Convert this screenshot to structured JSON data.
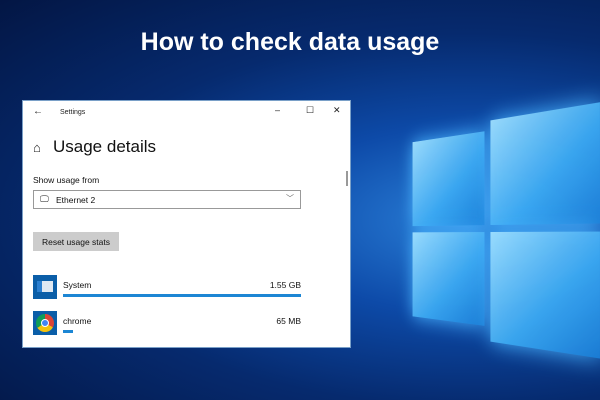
{
  "headline": "How to check data usage",
  "window": {
    "title": "Settings",
    "page_title": "Usage details",
    "show_label": "Show usage from",
    "selected_network": "Ethernet 2",
    "reset_label": "Reset usage stats"
  },
  "apps": [
    {
      "name": "System",
      "usage": "1.55 GB",
      "fraction": 1.0
    },
    {
      "name": "chrome",
      "usage": "65 MB",
      "fraction": 0.04
    }
  ]
}
